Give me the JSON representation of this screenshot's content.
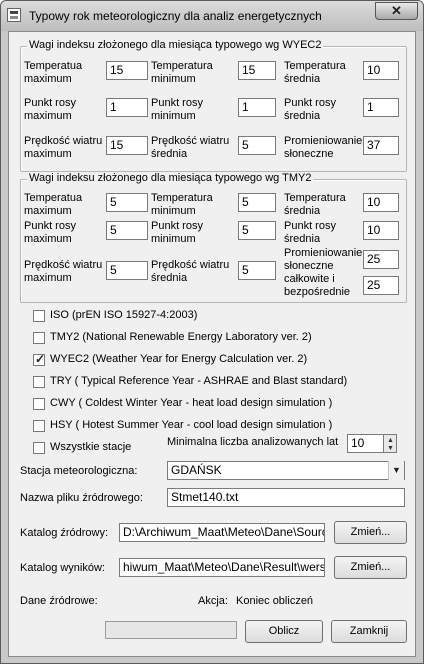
{
  "window": {
    "title": "Typowy rok meteorologiczny dla analiz energetycznych",
    "close_glyph": "✕"
  },
  "wyec2": {
    "title": "Wagi indeksu złożonego dla miesiąca typowego wg WYEC2",
    "temp_max_label": "Temperatua\nmaximum",
    "temp_max": "15",
    "temp_min_label": "Temperatura\nminimum",
    "temp_min": "15",
    "temp_avg_label": "Temperatura\nśrednia",
    "temp_avg": "10",
    "dew_max_label": "Punkt rosy\nmaximum",
    "dew_max": "1",
    "dew_min_label": "Punkt rosy\nminimum",
    "dew_min": "1",
    "dew_avg_label": "Punkt rosy\nśrednia",
    "dew_avg": "1",
    "wind_max_label": "Prędkość wiatru\nmaximum",
    "wind_max": "15",
    "wind_avg_label": "Prędkość wiatru\nśrednia",
    "wind_avg": "5",
    "solar_label": "Promieniowanie\nsłoneczne",
    "solar": "37"
  },
  "tmy2": {
    "title": "Wagi indeksu złożonego dla miesiąca typowego wg TMY2",
    "temp_max_label": "Temperatua\nmaximum",
    "temp_max": "5",
    "temp_min_label": "Temperatura\nminimum",
    "temp_min": "5",
    "temp_avg_label": "Temperatura\nśrednia",
    "temp_avg": "10",
    "dew_max_label": "Punkt rosy\nmaximum",
    "dew_max": "5",
    "dew_min_label": "Punkt rosy\nminimum",
    "dew_min": "5",
    "dew_avg_label": "Punkt rosy\nśrednia",
    "dew_avg": "10",
    "wind_max_label": "Prędkość wiatru\nmaximum",
    "wind_max": "5",
    "wind_avg_label": "Prędkość wiatru\nśrednia",
    "wind_avg": "5",
    "solar_label": "Promieniowanie\nsłoneczne\ncałkowite i\nbezpośrednie",
    "solar1": "25",
    "solar2": "25"
  },
  "options": [
    {
      "label": "ISO (prEN ISO 15927-4:2003)",
      "checked": false
    },
    {
      "label": "TMY2 (National Renewable Energy Laboratory ver. 2)",
      "checked": false
    },
    {
      "label": "WYEC2 (Weather Year for Energy Calculation ver. 2)",
      "checked": true
    },
    {
      "label": "TRY ( Typical Reference Year - ASHRAE and Blast standard)",
      "checked": false
    },
    {
      "label": "CWY ( Coldest Winter Year - heat load design simulation )",
      "checked": false
    },
    {
      "label": "HSY ( Hotest Summer Year - cool load design simulation )",
      "checked": false
    }
  ],
  "all_stations": {
    "label": "Wszystkie stacje",
    "checked": false
  },
  "min_years": {
    "label": "Minimalna liczba analizowanych lat",
    "value": "10"
  },
  "station": {
    "label": "Stacja meteorologiczna:",
    "value": "GDAŃSK"
  },
  "source_file": {
    "label": "Nazwa pliku źródrowego:",
    "value": "Stmet140.txt"
  },
  "source_dir": {
    "label": "Katalog źródrowy:",
    "value": "D:\\Archiwum_Maat\\Meteo\\Dane\\Source",
    "button": "Zmień..."
  },
  "result_dir": {
    "label": "Katalog wyników:",
    "value": "hiwum_Maat\\Meteo\\Dane\\Result\\wersja1",
    "button": "Zmień..."
  },
  "status": {
    "source_label": "Dane źródrowe:",
    "action_label": "Akcja:",
    "action_value": "Koniec obliczeń"
  },
  "buttons": {
    "compute": "Oblicz",
    "close": "Zamknij"
  },
  "colors": {
    "window_frame": "#c9c9c9",
    "client": "#f0f0f0"
  }
}
